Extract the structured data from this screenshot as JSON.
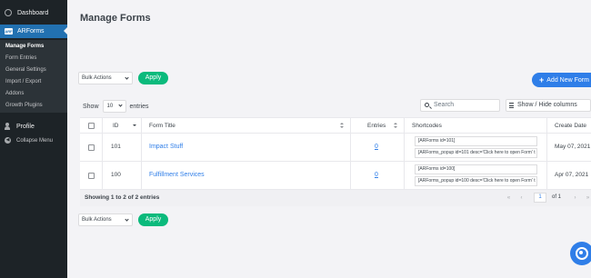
{
  "sidebar": {
    "dashboard": "Dashboard",
    "plugin": "ARForms",
    "plugin_icon": "ARF",
    "submenu": [
      "Manage Forms",
      "Form Entries",
      "General Settings",
      "Import / Export",
      "Addons",
      "Growth Plugins"
    ],
    "profile": "Profile",
    "collapse": "Collapse Menu"
  },
  "page": {
    "title": "Manage Forms",
    "bulk_actions": "Bulk Actions",
    "apply": "Apply",
    "add_new": "Add New Form",
    "show": "Show",
    "page_length": "10",
    "entries": "entries",
    "search_placeholder": "Search",
    "show_hide_columns": "Show / Hide columns"
  },
  "table": {
    "headers": {
      "id": "ID",
      "form_title": "Form Title",
      "entries": "Entries",
      "shortcodes": "Shortcodes",
      "create_date": "Create Date"
    },
    "rows": [
      {
        "id": "101",
        "title": "Impact Stuff",
        "entries": "0",
        "shortcode": "[ARForms id=101]",
        "popup": "[ARForms_popup id=101 desc='Click here to open Form' t",
        "date": "May 07, 2021"
      },
      {
        "id": "100",
        "title": "Fulfillment Services",
        "entries": "0",
        "shortcode": "[ARForms id=100]",
        "popup": "[ARForms_popup id=100 desc='Click here to open Form' t",
        "date": "Apr 07, 2021"
      }
    ],
    "info": "Showing 1 to 2 of 2 entries",
    "pagination": {
      "current": "1",
      "of": "of 1"
    }
  },
  "colors": {
    "sidebar_bg": "#1d2327",
    "active_menu": "#2271b1",
    "apply_green": "#0bba7c",
    "primary_blue": "#2f7ee8"
  }
}
